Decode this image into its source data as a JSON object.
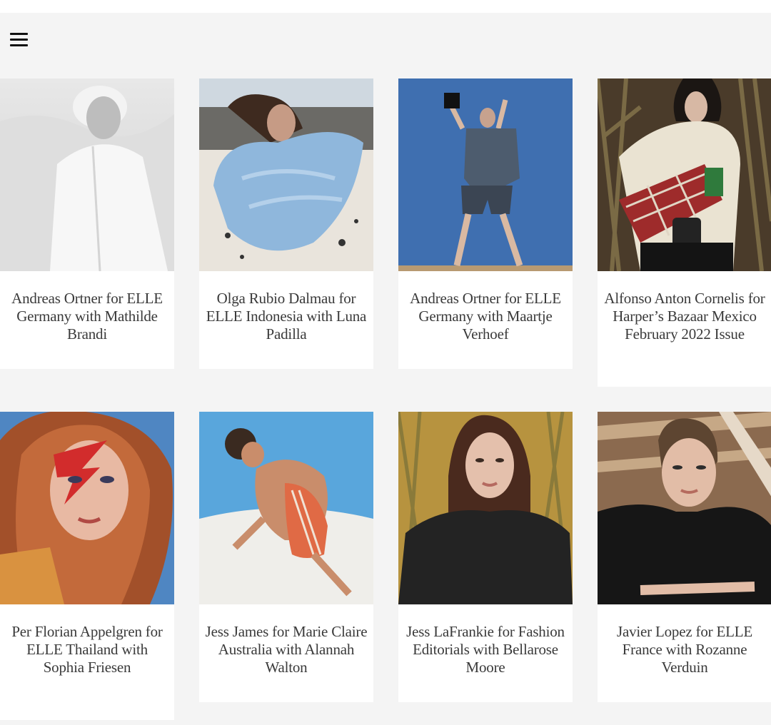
{
  "header": {
    "menu_icon": "hamburger-menu-icon"
  },
  "cards": [
    {
      "caption": "Andreas Ortner for ELLE Germany with Mathilde Brandi"
    },
    {
      "caption": "Olga Rubio Dalmau for ELLE Indonesia with Luna Padilla"
    },
    {
      "caption": "Andreas Ortner for ELLE Germany with Maartje Verhoef"
    },
    {
      "caption": "Alfonso Anton Cornelis for Harper’s Bazaar Mexico February 2022 Issue"
    },
    {
      "caption": "Per Florian Appelgren for ELLE Thailand with Sophia Friesen"
    },
    {
      "caption": "Jess James for Marie Claire Australia with Alannah Walton"
    },
    {
      "caption": "Jess LaFrankie for Fashion Editorials with Bellarose Moore"
    },
    {
      "caption": "Javier Lopez for ELLE France with Rozanne Verduin"
    }
  ]
}
